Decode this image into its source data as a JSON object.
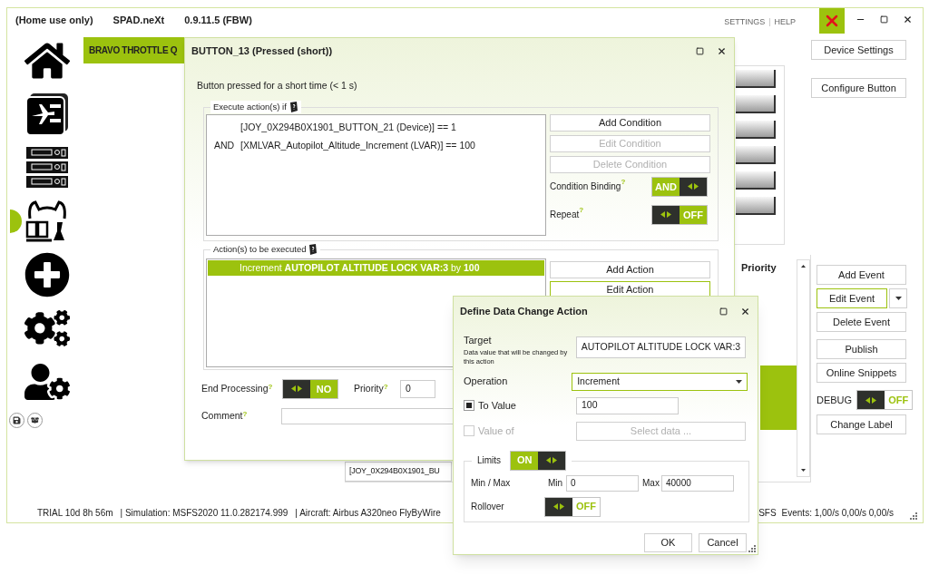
{
  "window": {
    "title_parts": [
      "(Home use only)",
      "SPAD.neXt",
      "0.9.11.5 (FBW)"
    ],
    "menu": [
      "SETTINGS",
      "HELP"
    ],
    "menu_separator": "|"
  },
  "sidebar": {
    "items": [
      {
        "kind": "home",
        "selected": false
      },
      {
        "kind": "checklist",
        "selected": false
      },
      {
        "kind": "panels",
        "selected": false
      },
      {
        "kind": "controllers",
        "selected": true
      },
      {
        "kind": "add",
        "selected": false
      },
      {
        "kind": "settings",
        "selected": false
      },
      {
        "kind": "support",
        "selected": false
      }
    ],
    "footer": [
      {
        "kind": "save"
      },
      {
        "kind": "package"
      }
    ]
  },
  "device_tab": {
    "label": "BRAVO THROTTLE Q"
  },
  "event_list": {
    "column": "Priority",
    "visible_row": "[JOY_0X294B0X1901_BU"
  },
  "device_buttons": [
    "Device Settings",
    "Configure Button"
  ],
  "event_buttons": [
    {
      "kind": "button",
      "label": "Add Event",
      "focused": false
    },
    {
      "kind": "split",
      "label": "Edit Event",
      "focused": true
    },
    {
      "kind": "button",
      "label": "Delete Event",
      "focused": false
    }
  ],
  "share_buttons": [
    "Publish",
    "Online Snippets"
  ],
  "debug": {
    "label": "DEBUG",
    "toggle": {
      "value": "OFF",
      "on": false,
      "kind": "outline"
    }
  },
  "change_label": "Change Label",
  "status_bar": {
    "left": [
      "TRIAL 10d 8h 56m",
      "| Simulation: MSFS2020 11.0.282174.999",
      "| Aircraft: Airbus A320neo FlyByWire"
    ],
    "right": [
      "SFS",
      "Events: 1,00/s 0,00/s 0,00/s"
    ]
  },
  "button_dialog": {
    "title": "BUTTON_13 (Pressed (short))",
    "description": "Button pressed for a short time (< 1 s)",
    "conditions_group": {
      "title": "Execute action(s) if",
      "rows": [
        {
          "expression": "[JOY_0X294B0X1901_BUTTON_21 (Device)] == 1"
        },
        {
          "operator": "AND",
          "expression": "[XMLVAR_Autopilot_Altitude_Increment (LVAR)] == 100"
        }
      ],
      "buttons": [
        {
          "label": "Add Condition",
          "disabled": false
        },
        {
          "label": "Edit Condition",
          "disabled": true
        },
        {
          "label": "Delete Condition",
          "disabled": true
        }
      ],
      "options": [
        {
          "label": "Condition Binding",
          "help": "?",
          "toggle": {
            "value": "AND",
            "on": true,
            "kind": "filled"
          }
        },
        {
          "label": "Repeat",
          "help": "?",
          "toggle": {
            "value": "OFF",
            "on": false,
            "kind": "filled"
          }
        }
      ]
    },
    "actions_group": {
      "title": "Action(s) to be executed",
      "rows": [
        {
          "text": "Increment **AUTOPILOT ALTITUDE LOCK VAR:3** by **100**",
          "selected": true
        }
      ],
      "buttons": [
        {
          "label": "Add Action",
          "focused": false
        },
        {
          "label": "Edit Action",
          "focused": true
        }
      ]
    },
    "end_processing": {
      "label": "End Processing",
      "help": "?",
      "toggle": {
        "value": "NO",
        "on": false,
        "kind": "filled"
      }
    },
    "priority": {
      "label": "Priority",
      "help": "?",
      "value": "0"
    },
    "comment": {
      "label": "Comment",
      "help": "?"
    }
  },
  "data_dialog": {
    "title": "Define Data Change Action",
    "target": {
      "label": "Target",
      "hint": "Data value that will be changed by this action",
      "value": "AUTOPILOT ALTITUDE LOCK VAR:3"
    },
    "operation": {
      "label": "Operation",
      "value": "Increment"
    },
    "to_value": {
      "label": "To Value",
      "checked": true,
      "value": "100"
    },
    "value_of": {
      "label": "Value of",
      "checked": false,
      "disabled": true,
      "button": "Select data ..."
    },
    "limits": {
      "label": "Limits",
      "toggle": {
        "value": "ON",
        "on": true,
        "kind": "filled"
      },
      "range_label": "Min / Max",
      "min_label": "Min",
      "min": "0",
      "max_label": "Max",
      "max": "40000"
    },
    "rollover": {
      "label": "Rollover",
      "toggle": {
        "value": "OFF",
        "on": false,
        "kind": "outline"
      }
    },
    "buttons": [
      "OK",
      "Cancel"
    ]
  }
}
